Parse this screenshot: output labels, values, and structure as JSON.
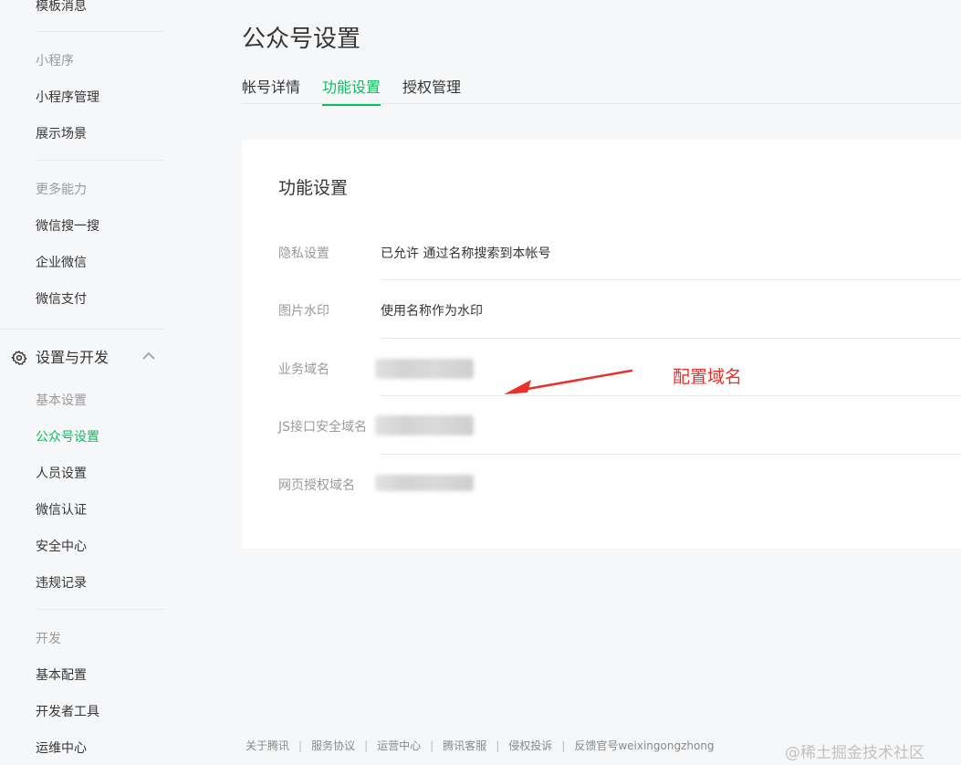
{
  "sidebar": {
    "top_item": "模板消息",
    "cat_miniprogram": "小程序",
    "item_mp_manage": "小程序管理",
    "item_display_scene": "展示场景",
    "cat_more": "更多能力",
    "item_wx_search": "微信搜一搜",
    "item_work_wx": "企业微信",
    "item_wx_pay": "微信支付",
    "group_settings": "设置与开发",
    "cat_basic": "基本设置",
    "item_account_settings": "公众号设置",
    "item_member_settings": "人员设置",
    "item_wx_verify": "微信认证",
    "item_security": "安全中心",
    "item_violation": "违规记录",
    "cat_dev": "开发",
    "item_basic_config": "基本配置",
    "item_dev_tools": "开发者工具",
    "item_ops_center": "运维中心"
  },
  "main": {
    "title": "公众号设置",
    "tabs": [
      "帐号详情",
      "功能设置",
      "授权管理"
    ],
    "active_tab": "功能设置",
    "card": {
      "title": "功能设置",
      "rows": [
        {
          "label": "隐私设置",
          "value": "已允许 通过名称搜索到本帐号"
        },
        {
          "label": "图片水印",
          "value": "使用名称作为水印"
        },
        {
          "label": "业务域名",
          "value": ""
        },
        {
          "label": "JS接口安全域名",
          "value": ""
        },
        {
          "label": "网页授权域名",
          "value": ""
        }
      ]
    }
  },
  "annotation": {
    "text": "配置域名",
    "color": "#e8312b"
  },
  "footer": {
    "links": [
      "关于腾讯",
      "服务协议",
      "运营中心",
      "腾讯客服",
      "侵权投诉",
      "反馈官号weixingongzhong"
    ]
  },
  "watermark": "@稀土掘金技术社区",
  "colors": {
    "accent": "#07c160",
    "background": "#f6f7f9",
    "card": "#ffffff"
  }
}
